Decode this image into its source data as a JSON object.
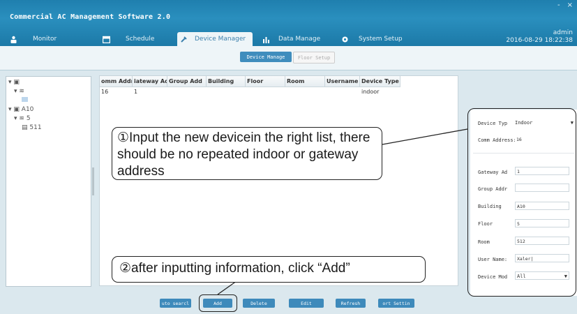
{
  "app": {
    "title": "Commercial AC Management Software 2.0",
    "min_label": "-",
    "close_label": "×"
  },
  "tabs": [
    {
      "label": "Monitor"
    },
    {
      "label": "Schedule"
    },
    {
      "label": "Device Manager"
    },
    {
      "label": "Data Manage"
    },
    {
      "label": "System Setup"
    }
  ],
  "user": {
    "name": "admin",
    "datetime": "2016-08-29 18:22:38"
  },
  "subtabs": {
    "device_manage": "Device Manage",
    "floor_setup": "Floor Setup"
  },
  "tree": {
    "node1": "",
    "node1_child": "",
    "node2": "A10",
    "node2_child": "5",
    "node2_leaf": "511"
  },
  "grid": {
    "columns": [
      "omm Addre",
      "iateway Adc",
      "Group Add",
      "Building",
      "Floor",
      "Room",
      "Username",
      "Device Type"
    ],
    "rows": [
      [
        "16",
        "1",
        "",
        "",
        "",
        "",
        "",
        "indoor"
      ]
    ]
  },
  "buttons": {
    "auto_search": "uto searcl",
    "add": "Add",
    "delete": "Delete",
    "edit": "Edit",
    "refresh": "Refresh",
    "port_settings": "ort Settin"
  },
  "form": {
    "device_type_label": "Device Typ",
    "device_type_value": "Indoor",
    "comm_address_label": "Comm Address:",
    "comm_address_value": "16",
    "gateway_label": "Gateway Ad",
    "gateway_value": "1",
    "group_label": "Group Addr",
    "group_value": "",
    "building_label": "Building",
    "building_value": "A10",
    "floor_label": "Floor",
    "floor_value": "5",
    "room_label": "Room",
    "room_value": "512",
    "username_label": "User Name:",
    "username_value": "Xaler|",
    "device_mod_label": "Device Mod",
    "device_mod_value": "All"
  },
  "callouts": {
    "step1": "①Input the new devicein the right list, there should be no repeated indoor or gateway address",
    "step2": "②after inputting information, click “Add”"
  },
  "colors": {
    "titlebar": "#2a8fbe",
    "accent_button": "#3e8abb",
    "background": "#dbe8ee"
  }
}
